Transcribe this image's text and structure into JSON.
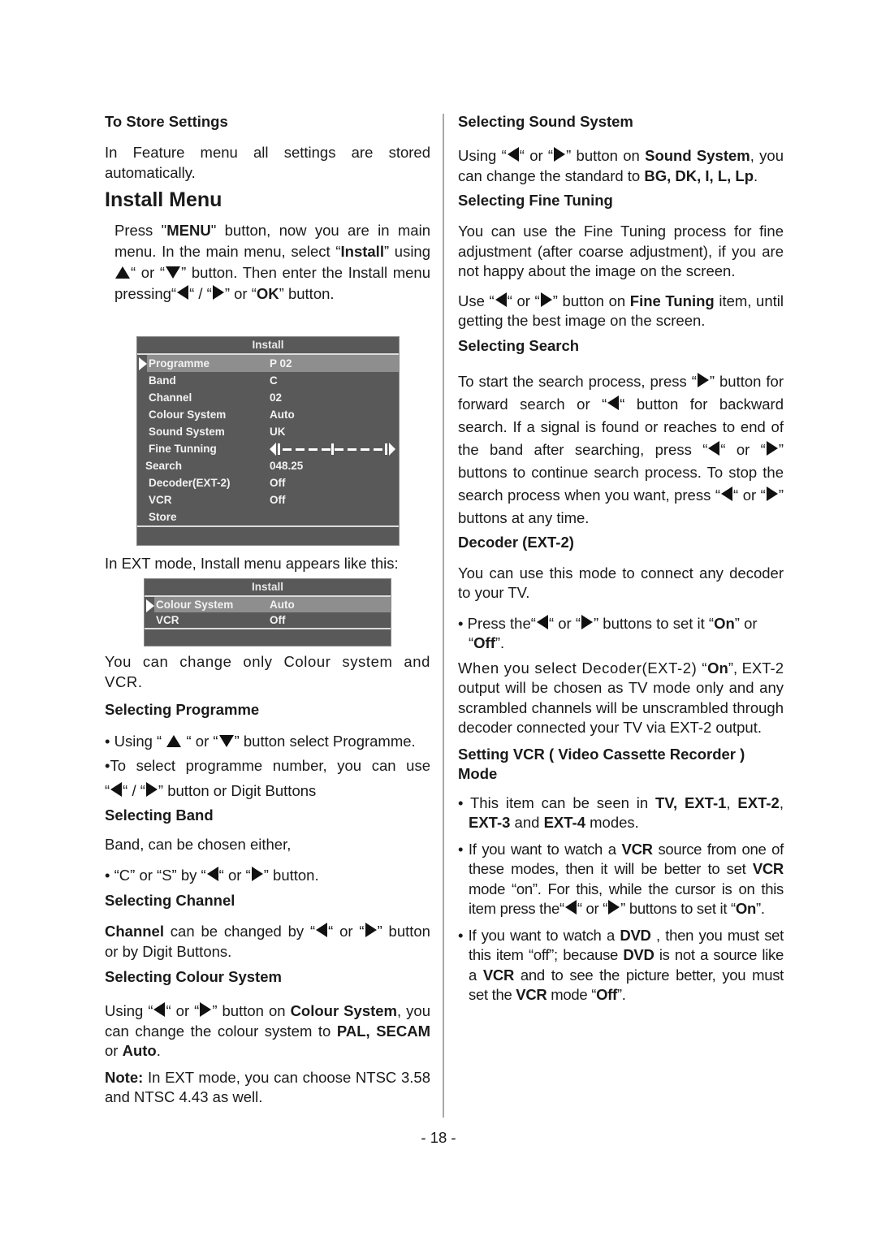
{
  "page_number": "- 18 -",
  "left": {
    "store_heading": "To Store Settings",
    "store_text": "In Feature menu all settings are stored automatically.",
    "install_title": "Install Menu",
    "install_intro": {
      "p1a": "Press \"",
      "p1b": "MENU",
      "p1c": "\" button, now you are in main menu. In the main menu, select “",
      "p1d": "Install",
      "p1e": "” using ",
      "p1f": "“ or “",
      "p1g": "” button. Then enter the Install menu pressing“",
      "p1h": "“ /  “",
      "p1i": "” or “",
      "p1j": "OK",
      "p1k": "” button."
    },
    "osd_main": {
      "title": "Install",
      "rows": [
        {
          "label": "Programme",
          "value": "P 02",
          "selected": true
        },
        {
          "label": "Band",
          "value": "C"
        },
        {
          "label": "Channel",
          "value": "02"
        },
        {
          "label": "Colour  System",
          "value": "Auto"
        },
        {
          "label": "Sound System",
          "value": "UK"
        },
        {
          "label": "Fine  Tunning",
          "value": ""
        },
        {
          "label": "Search",
          "value": "048.25"
        },
        {
          "label": "Decoder(EXT-2)",
          "value": "Off"
        },
        {
          "label": "VCR",
          "value": "Off"
        },
        {
          "label": "Store",
          "value": ""
        }
      ],
      "fine_tuning_level": 0.5
    },
    "ext_intro": "In EXT mode, Install menu  appears like this:",
    "osd_ext": {
      "title": "Install",
      "rows": [
        {
          "label": "Colour  System",
          "value": "Auto",
          "selected": true
        },
        {
          "label": "VCR",
          "value": "Off"
        }
      ]
    },
    "ext_note": "You can change only Colour system and VCR.",
    "programme_heading": "Selecting Programme",
    "programme_b1a": "• Using “ ",
    "programme_b1b": " “ or “",
    "programme_b1c": "” button select Programme.",
    "programme_b2": "•To select programme number, you can use",
    "programme_b3a": "“",
    "programme_b3b": "“ /  “",
    "programme_b3c": "” button or Digit Buttons",
    "band_heading": "Selecting Band",
    "band_text": "Band, can be chosen either,",
    "band_b1a": "• “C” or “S” by “",
    "band_b1b": "“ or “",
    "band_b1c": "”  button.",
    "channel_heading": "Selecting Channel",
    "channel_a": "Channel",
    "channel_b": " can be changed by “",
    "channel_c": "“ or “",
    "channel_d": "”  button or by Digit Buttons.",
    "colour_heading": "Selecting Colour System",
    "colour_a": "Using “",
    "colour_b": "“ or “",
    "colour_c": "”  button on ",
    "colour_d": "Colour System",
    "colour_e": ", you can change the colour system to ",
    "colour_f": "PAL, SECAM",
    "colour_g": " or ",
    "colour_h": "Auto",
    "colour_i": ".",
    "note_label": "Note:",
    "note_text": " In EXT mode, you can choose NTSC 3.58 and NTSC 4.43 as well."
  },
  "right": {
    "sound_heading": "Selecting Sound System",
    "sound_a": "Using “",
    "sound_b": "“ or “",
    "sound_c": "”  button on ",
    "sound_d": "Sound System",
    "sound_e": ", you can change the standard to ",
    "sound_f": "BG, DK, I, L, Lp",
    "sound_g": ".",
    "fine_heading": "Selecting Fine Tuning",
    "fine_text": "You can use the Fine Tuning process for fine adjustment (after coarse adjustment), if you are not happy about the image on the screen.",
    "fine_a": "Use “",
    "fine_b": "“ or “",
    "fine_c": "”  button on ",
    "fine_d": "Fine Tuning",
    "fine_e": " item, until getting the best image on the screen.",
    "search_heading": "Selecting Search",
    "search_a": "To start the search process, press  “",
    "search_b": "” button for forward search or “",
    "search_c": "“ button for backward search. If a signal is found or reaches to end of the band after searching, press “",
    "search_d": "“ or “",
    "search_e": "” buttons to continue search process. To stop the search process  when you want, press “",
    "search_f": "“ or “",
    "search_g": "”  buttons at any time.",
    "decoder_heading": "Decoder (EXT-2)",
    "decoder_text": "You can use this mode to connect any decoder to your TV.",
    "decoder_b1a": "• Press the“",
    "decoder_b1b": "“ or “",
    "decoder_b1c": "” buttons to set it “",
    "decoder_b1d": "On",
    "decoder_b1e": "” or “",
    "decoder_b1f": "Off",
    "decoder_b1g": "”.",
    "decoder_p2a": "When you select Decoder(EXT-2) “",
    "decoder_p2b": "On",
    "decoder_p2c": "”, EXT-2 output will be chosen as TV mode only and any scrambled channels will be unscrambled through decoder connected your TV via EXT-2 output.",
    "vcr_heading": "Setting VCR ( Video Cassette Recorder ) Mode",
    "vcr_b1a": "• This item can be seen in ",
    "vcr_b1b": "TV, EXT-1",
    "vcr_b1c": ", ",
    "vcr_b1d": "EXT-2",
    "vcr_b1e": ", ",
    "vcr_b1f": "EXT-3",
    "vcr_b1g": " and ",
    "vcr_b1h": "EXT-4",
    "vcr_b1i": " modes.",
    "vcr_b2a": "• If you want to watch a ",
    "vcr_b2b": "VCR",
    "vcr_b2c": " source from one of these modes, then  it will be better to set ",
    "vcr_b2d": "VCR",
    "vcr_b2e": " mode “on”. For this, while the cursor is on this item press the“",
    "vcr_b2f": "“ or “",
    "vcr_b2g": "” buttons to set it “",
    "vcr_b2h": "On",
    "vcr_b2i": "”.",
    "vcr_b3a": "• If you want to watch a ",
    "vcr_b3b": "DVD",
    "vcr_b3c": " , then you must set this item “off”; because ",
    "vcr_b3d": "DVD",
    "vcr_b3e": " is not a source like a ",
    "vcr_b3f": "VCR",
    "vcr_b3g": " and to see the picture better, you must set the ",
    "vcr_b3h": "VCR",
    "vcr_b3i": " mode “",
    "vcr_b3j": "Off",
    "vcr_b3k": "”."
  }
}
